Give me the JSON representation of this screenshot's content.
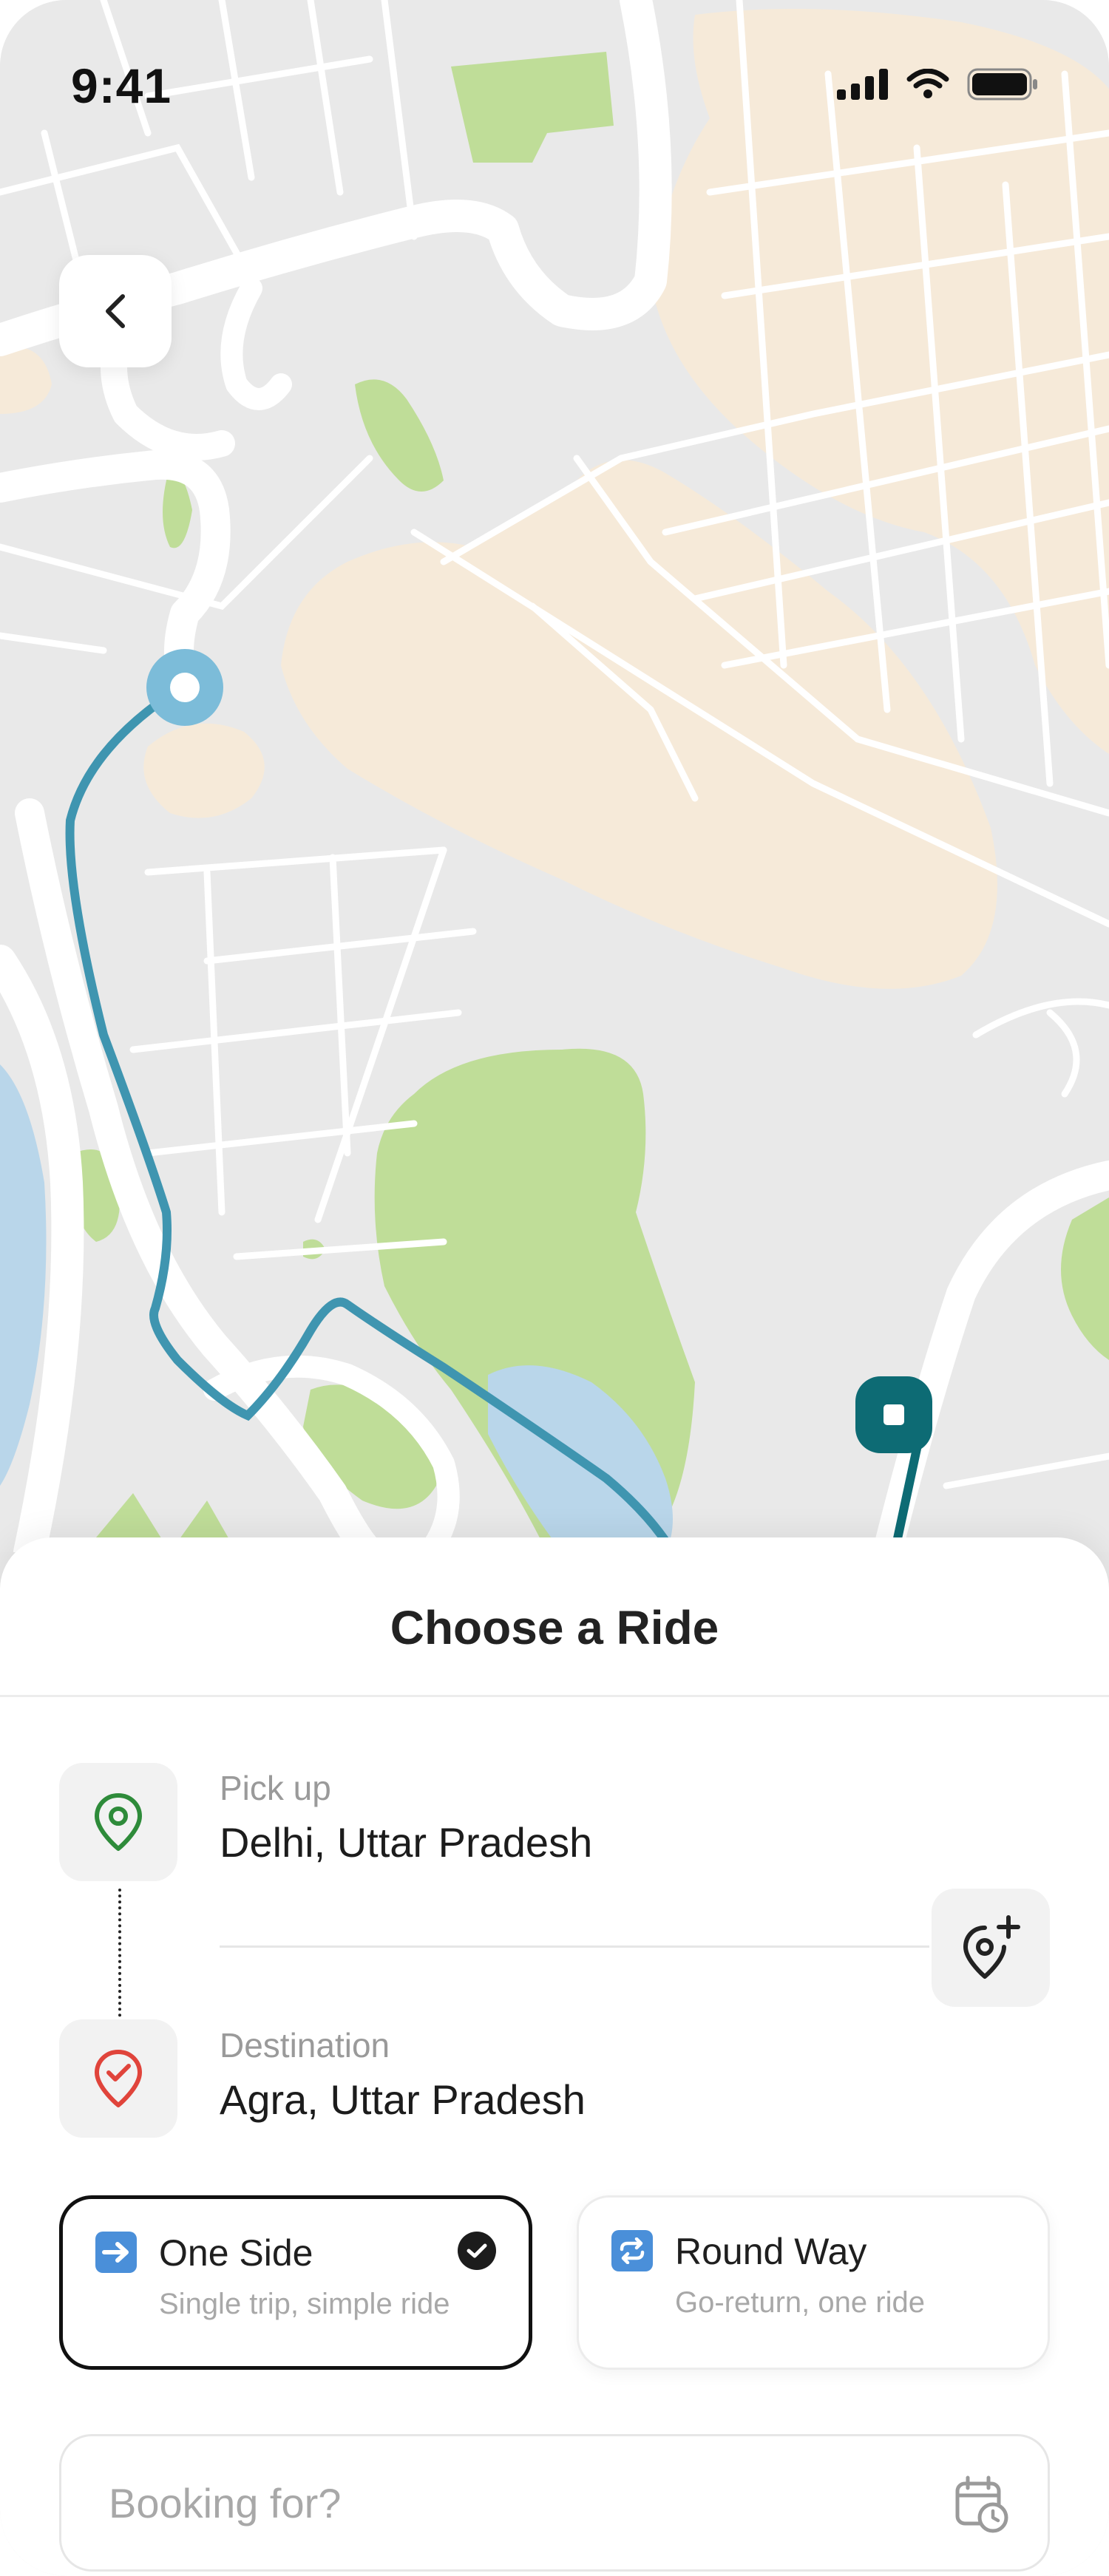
{
  "status_bar": {
    "time": "9:41"
  },
  "map": {
    "pickup_marker_color": "#7cbcd9",
    "destination_marker_color": "#0d6b74",
    "route_color": "#3f95b0"
  },
  "sheet": {
    "title": "Choose a Ride",
    "pickup": {
      "label": "Pick up",
      "value": "Delhi, Uttar Pradesh"
    },
    "destination": {
      "label": "Destination",
      "value": "Agra, Uttar Pradesh"
    },
    "options": [
      {
        "title": "One Side",
        "subtitle": "Single trip, simple ride",
        "selected": true,
        "icon": "arrow-right-icon"
      },
      {
        "title": "Round Way",
        "subtitle": "Go-return, one ride",
        "selected": false,
        "icon": "repeat-icon"
      }
    ],
    "booking": {
      "placeholder": "Booking for?"
    }
  },
  "colors": {
    "pickup_icon": "#2e8b3a",
    "destination_icon": "#e0443b",
    "option_icon_bg": "#4a8fd9"
  }
}
